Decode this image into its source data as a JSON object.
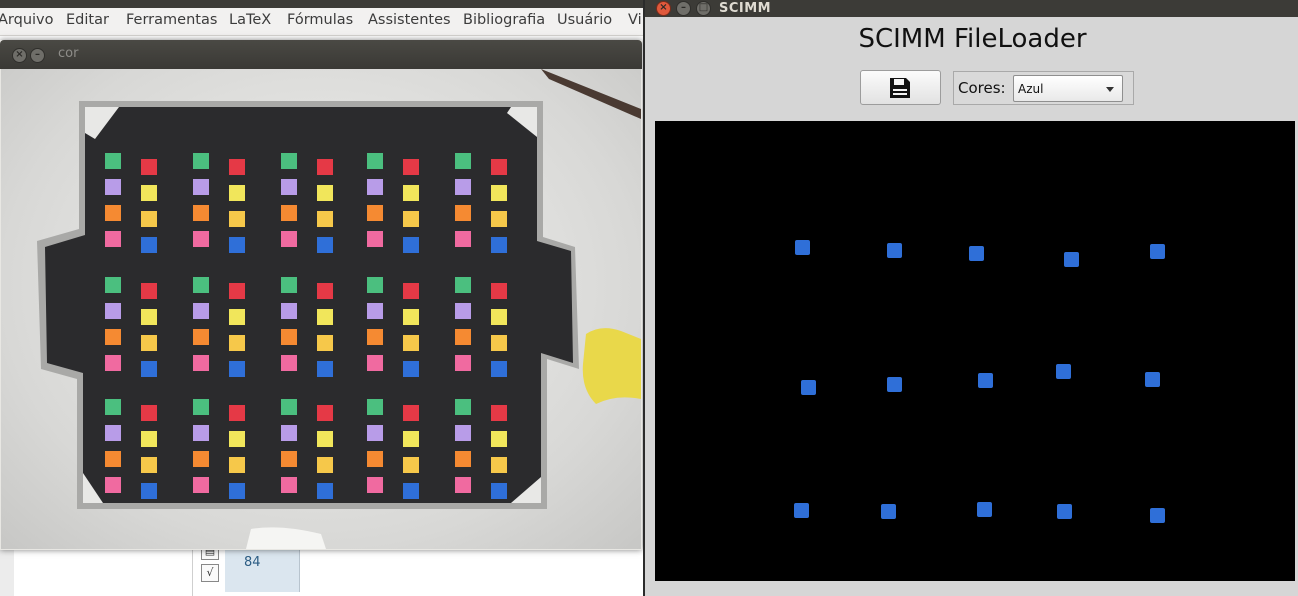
{
  "background_app": {
    "menu": [
      "Arquivo",
      "Editar",
      "Ferramentas",
      "LaTeX",
      "Fórmulas",
      "Assistentes",
      "Bibliografia",
      "Usuário",
      "Vi"
    ],
    "cell_value": "84",
    "sqrt_icon": "sqrt-icon"
  },
  "cor_window": {
    "title": "cor",
    "close_icon": "close-icon",
    "minimize_icon": "minimize-icon"
  },
  "scimm_window": {
    "title": "SCIMM",
    "heading": "SCIMM FileLoader",
    "save_icon": "save-icon",
    "colors_label": "Cores:",
    "colors_selected": "Azul",
    "preview_color": "#2f6fd8"
  }
}
